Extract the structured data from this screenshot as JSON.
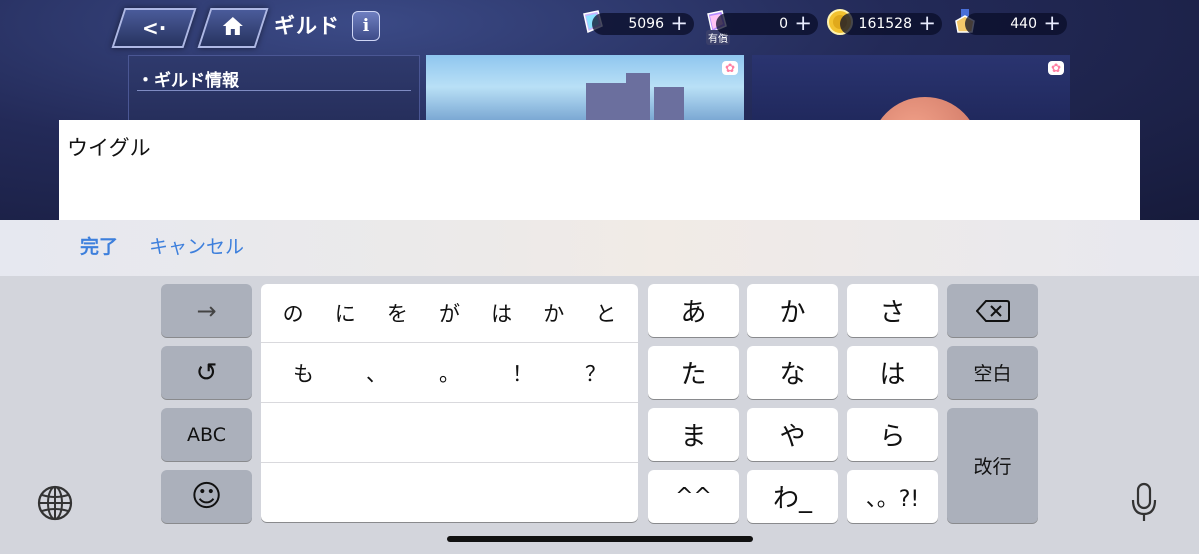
{
  "game": {
    "header": {
      "title": "ギルド",
      "info_label": "i"
    },
    "currencies": [
      {
        "name": "jewel",
        "value": "5096"
      },
      {
        "name": "paid-jewel",
        "value": "0",
        "tag": "有償"
      },
      {
        "name": "mana",
        "value": "161528"
      },
      {
        "name": "medal",
        "value": "440"
      }
    ],
    "guild_info": {
      "title": "・ギルド情報"
    }
  },
  "input": {
    "text": "ウイグル"
  },
  "accessory": {
    "done_label": "完了",
    "cancel_label": "キャンセル"
  },
  "keyboard": {
    "candidate_rows": [
      [
        "の",
        "に",
        "を",
        "が",
        "は",
        "か",
        "と"
      ],
      [
        "も",
        "、",
        "。",
        "！",
        "？"
      ]
    ],
    "left_keys": {
      "next": "→",
      "undo": "↺",
      "abc": "ABC",
      "emoji": "☺"
    },
    "kana_keys": [
      "あ",
      "か",
      "さ",
      "た",
      "な",
      "は",
      "ま",
      "や",
      "ら",
      "^^",
      "わ_",
      "、。?!"
    ],
    "right_keys": {
      "delete": "⌫",
      "space": "空白",
      "return": "改行"
    }
  }
}
